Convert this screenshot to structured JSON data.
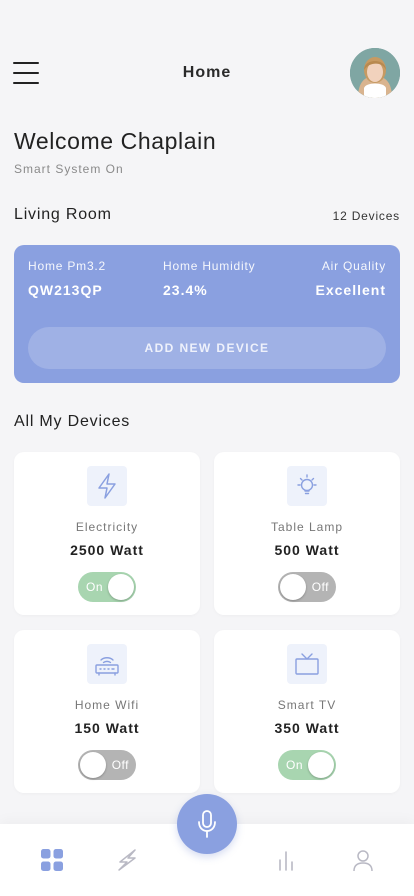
{
  "header": {
    "title": "Home"
  },
  "welcome": {
    "title": "Welcome Chaplain",
    "subtitle": "Smart System On"
  },
  "room": {
    "name": "Living Room",
    "device_count": "12 Devices",
    "stats": [
      {
        "label": "Home Pm3.2",
        "value": "QW213QP"
      },
      {
        "label": "Home Humidity",
        "value": "23.4%"
      },
      {
        "label": "Air Quality",
        "value": "Excellent"
      }
    ],
    "add_button": "ADD NEW DEVICE"
  },
  "devices_section": {
    "title": "All My Devices",
    "devices": [
      {
        "name": "Electricity",
        "watt": "2500 Watt",
        "icon": "lightning-icon",
        "state": "On"
      },
      {
        "name": "Table Lamp",
        "watt": "500 Watt",
        "icon": "lightbulb-icon",
        "state": "Off"
      },
      {
        "name": "Home Wifi",
        "watt": "150 Watt",
        "icon": "router-icon",
        "state": "Off"
      },
      {
        "name": "Smart TV",
        "watt": "350 Watt",
        "icon": "tv-icon",
        "state": "On"
      }
    ]
  },
  "nav": {
    "items": [
      "grid-icon",
      "lightning-icon",
      "mic-icon",
      "bar-chart-icon",
      "user-icon"
    ],
    "active": "grid-icon"
  },
  "colors": {
    "accent": "#8aa0e0",
    "toggle_on": "#a8d5b0",
    "toggle_off": "#b4b4b4",
    "background": "#f5f5f7"
  }
}
